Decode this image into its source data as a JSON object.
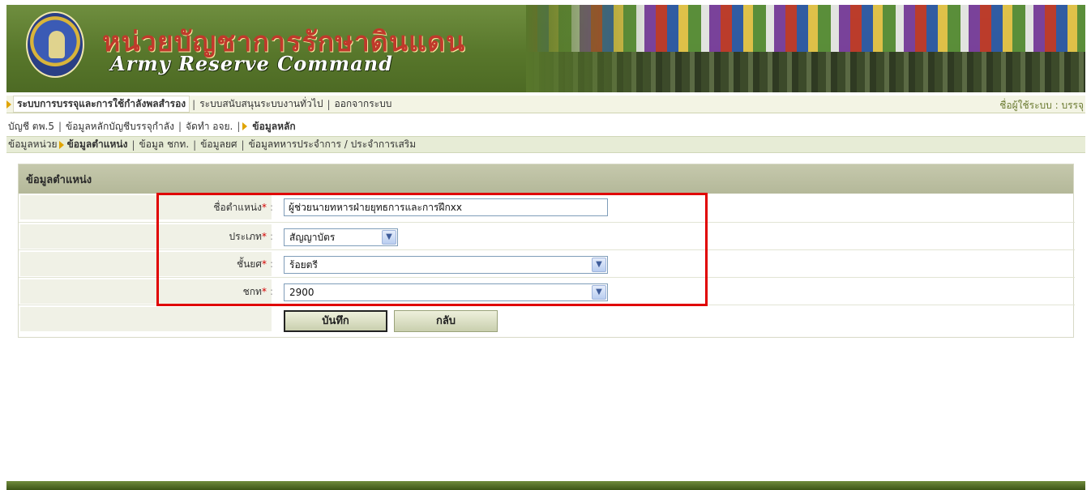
{
  "header": {
    "title_th": "หน่วยบัญชาการรักษาดินแดน",
    "title_en": "Army Reserve Command"
  },
  "nav1": {
    "items": [
      {
        "label": "ระบบการบรรจุและการใช้กำลังพลสำรอง",
        "active": true
      },
      {
        "label": "ระบบสนับสนุนระบบงานทั่วไป",
        "active": false
      },
      {
        "label": "ออกจากระบบ",
        "active": false
      }
    ],
    "user_label": "ชื่อผู้ใช้ระบบ : บรรจุ"
  },
  "nav2": {
    "items": [
      {
        "label": "บัญชี ตพ.5",
        "active": false
      },
      {
        "label": "ข้อมูลหลักบัญชีบรรจุกำลัง",
        "active": false
      },
      {
        "label": "จัดทำ อจย.",
        "active": false
      },
      {
        "label": "ข้อมูลหลัก",
        "active": true
      }
    ]
  },
  "nav3": {
    "items": [
      {
        "label": "ข้อมูลหน่วย",
        "active": false
      },
      {
        "label": "ข้อมูลตำแหน่ง",
        "active": true
      },
      {
        "label": "ข้อมูล ชกท.",
        "active": false
      },
      {
        "label": "ข้อมูลยศ",
        "active": false
      },
      {
        "label": "ข้อมูลทหารประจำการ / ประจำการเสริม",
        "active": false
      }
    ]
  },
  "form": {
    "heading": "ข้อมูลตำแหน่ง",
    "required_mark": "*",
    "colon": ":",
    "fields": {
      "position_name": {
        "label": "ชื่อตำแหน่ง",
        "value": "ผู้ช่วยนายทหารฝ่ายยุทธการและการฝึกxx"
      },
      "type": {
        "label": "ประเภท",
        "value": "สัญญาบัตร"
      },
      "rank": {
        "label": "ชั้นยศ",
        "value": "ร้อยตรี"
      },
      "mos": {
        "label": "ชกท",
        "value": "2900"
      }
    },
    "save_label": "บันทึก",
    "back_label": "กลับ"
  },
  "colors": {
    "banner_green": "#58772b",
    "highlight_red": "#e00000",
    "active_arrow": "#e0a400"
  },
  "icons": {
    "dropdown": "chevron-down-icon",
    "nav_arrow": "triangle-right-icon",
    "logo": "emblem-logo"
  }
}
